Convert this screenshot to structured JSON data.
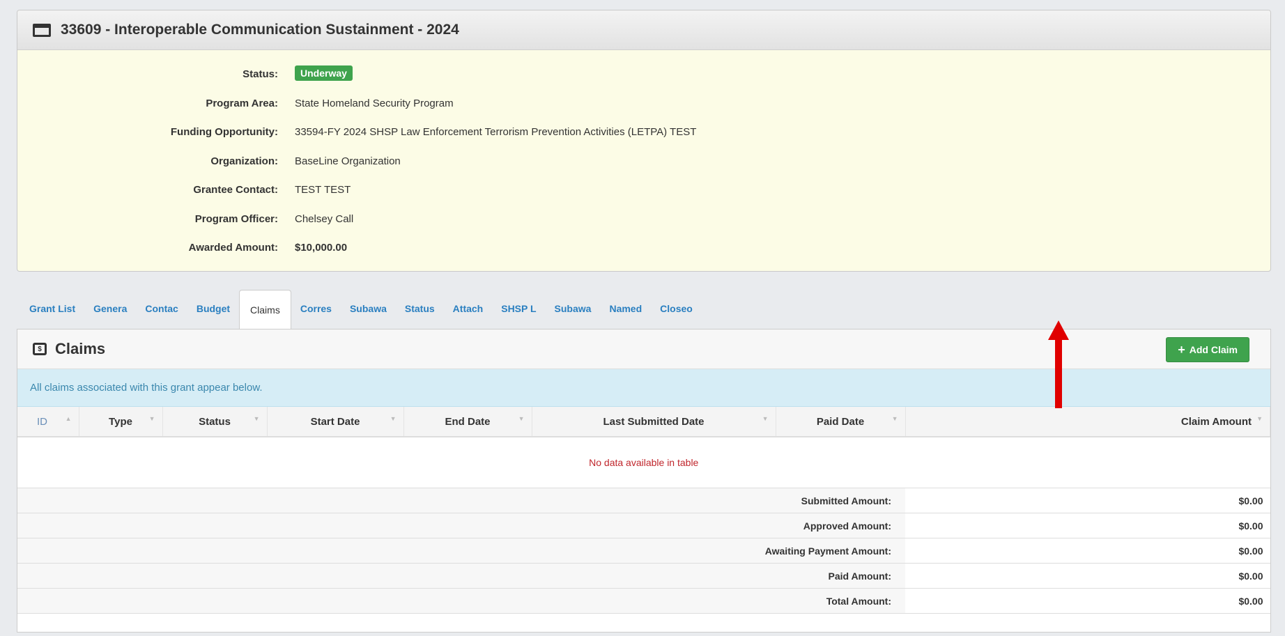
{
  "grant": {
    "title": "33609 - Interoperable Communication Sustainment - 2024",
    "fields": [
      {
        "label": "Status:",
        "value": "Underway",
        "type": "badge"
      },
      {
        "label": "Program Area:",
        "value": "State Homeland Security Program"
      },
      {
        "label": "Funding Opportunity:",
        "value": "33594-FY 2024 SHSP Law Enforcement Terrorism Prevention Activities (LETPA) TEST"
      },
      {
        "label": "Organization:",
        "value": "BaseLine Organization"
      },
      {
        "label": "Grantee Contact:",
        "value": "TEST TEST"
      },
      {
        "label": "Program Officer:",
        "value": "Chelsey Call"
      },
      {
        "label": "Awarded Amount:",
        "value": "$10,000.00",
        "strong": true
      }
    ]
  },
  "tabs": [
    "Grant List",
    "Genera",
    "Contac",
    "Budget",
    "Claims",
    "Corres",
    "Subawa",
    "Status",
    "Attach",
    "SHSP L",
    "Subawa",
    "Named",
    "Closeo"
  ],
  "active_tab": "Claims",
  "claims": {
    "title": "Claims",
    "add_label": "Add Claim",
    "info": "All claims associated with this grant appear below.",
    "columns": [
      "ID",
      "Type",
      "Status",
      "Start Date",
      "End Date",
      "Last Submitted Date",
      "Paid Date",
      "Claim Amount"
    ],
    "empty_message": "No data available in table",
    "summary": [
      {
        "label": "Submitted Amount:",
        "value": "$0.00"
      },
      {
        "label": "Approved Amount:",
        "value": "$0.00"
      },
      {
        "label": "Awaiting Payment Amount:",
        "value": "$0.00"
      },
      {
        "label": "Paid Amount:",
        "value": "$0.00"
      },
      {
        "label": "Total Amount:",
        "value": "$0.00"
      }
    ]
  },
  "colors": {
    "accent_green": "#3fa34d",
    "link_blue": "#2a7fc0",
    "info_bg": "#d6edf6",
    "annotation_arrow": "#e00000"
  }
}
